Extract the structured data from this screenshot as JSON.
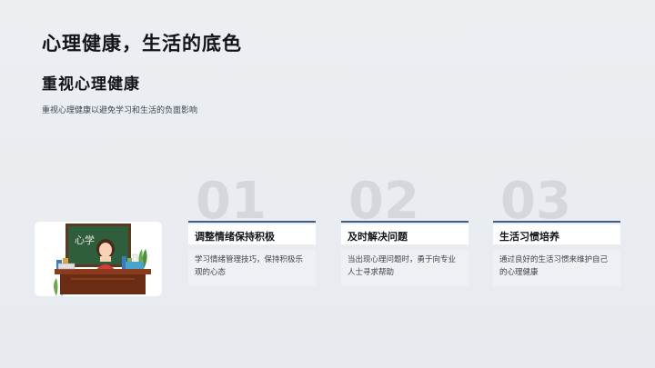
{
  "slide": {
    "title": "心理健康，生活的底色",
    "section_title": "重视心理健康",
    "subtitle": "重视心理健康以避免学习和生活的负面影响"
  },
  "illustration": {
    "board_text": "心学"
  },
  "cards": [
    {
      "number": "01",
      "heading": "调整情绪保持积极",
      "body": "学习情绪管理技巧，保持积极乐观的心态"
    },
    {
      "number": "02",
      "heading": "及时解决问题",
      "body": "当出现心理问题时，勇于向专业人士寻求帮助"
    },
    {
      "number": "03",
      "heading": "生活习惯培养",
      "body": "通过良好的生活习惯来维护自己的心理健康"
    }
  ],
  "colors": {
    "accent_rule": "#3e5f83",
    "number_gray": "#d4d7dc"
  }
}
